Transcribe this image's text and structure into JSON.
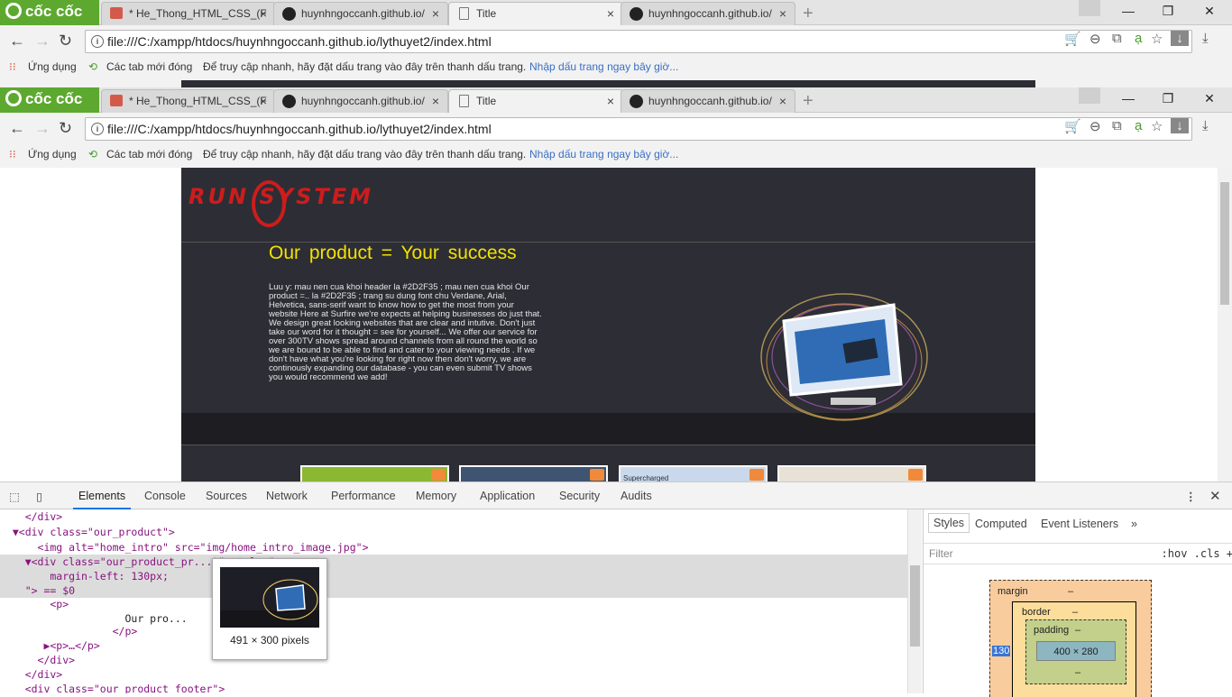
{
  "browser": {
    "brand": "cốc cốc",
    "tabs": [
      {
        "label": "* He_Thong_HTML_CSS_(F"
      },
      {
        "label": "huynhngoccanh.github.io/"
      },
      {
        "label": "Title"
      },
      {
        "label": "huynhngoccanh.github.io/"
      }
    ],
    "close_glyph": "×",
    "url": "file:///C:/xampp/htdocs/huynhngoccanh.github.io/lythuyet2/index.html",
    "bookmarks": {
      "apps": "Ứng dụng",
      "recent": "Các tab mới đóng",
      "hint": "Để truy cập nhanh, hãy đặt dấu trang vào đây trên thanh dấu trang.",
      "link": "Nhập dấu trang ngay bây giờ..."
    }
  },
  "site": {
    "brand": "RUN SYSTEM",
    "headline": "Our product = Your success",
    "description": "Luu y: mau nen cua khoi header la #2D2F35 ; mau nen cua khoi Our product =.. la #2D2F35 ; trang su dung font chu Verdane, Arial, Helvetica, sans-serif want to know how to get the most from your website Here at Surfire we're expects at helping businesses do just that. We design great looking websites that are clear and intutive. Don't just take our word for it thought = see for yourself... We offer our service for over 300TV shows spread around channels from all round the world so we are bound to be able to find and cater to your viewing needs . If we don't have what you're looking for right now then don't worry, we are continously expanding our database - you can even submit TV shows you would recommend we add!",
    "thumb_caption": "Supercharged",
    "colors": {
      "header_bg": "#2D2F35",
      "headline": "#f2e200",
      "brand": "#cc1d1d"
    }
  },
  "devtools": {
    "tabs": [
      "Elements",
      "Console",
      "Sources",
      "Network",
      "Performance",
      "Memory",
      "Application",
      "Security",
      "Audits"
    ],
    "code": [
      {
        "text": "    </div>"
      },
      {
        "text": "  ▼<div class=\"our_product\">"
      },
      {
        "text": "      <img alt=\"home_intro\" src=\"img/home_intro_image.jpg\">"
      },
      {
        "text": "    ▼<div class=\"our_product_pr...t\" style=\""
      },
      {
        "text": "        margin-left: 130px;"
      },
      {
        "text": "    \"> == $0"
      },
      {
        "text": "        <p>"
      },
      {
        "text": "                    Our pro...                  s"
      },
      {
        "text": "                  </p>"
      },
      {
        "text": "       ▶<p>…</p>"
      },
      {
        "text": "      </div>"
      },
      {
        "text": "    </div>"
      },
      {
        "text": "    <div class=\"our_product_footer\">"
      }
    ],
    "tooltip": "491 × 300 pixels",
    "side_tabs": [
      "Styles",
      "Computed",
      "Event Listeners",
      "»"
    ],
    "filter": "Filter",
    "filter_tools": ":hov  .cls  +",
    "box": {
      "margin": "margin",
      "border": "border",
      "padding": "padding",
      "dash": "–",
      "content": "400 × 280",
      "margin_left": "130"
    }
  }
}
